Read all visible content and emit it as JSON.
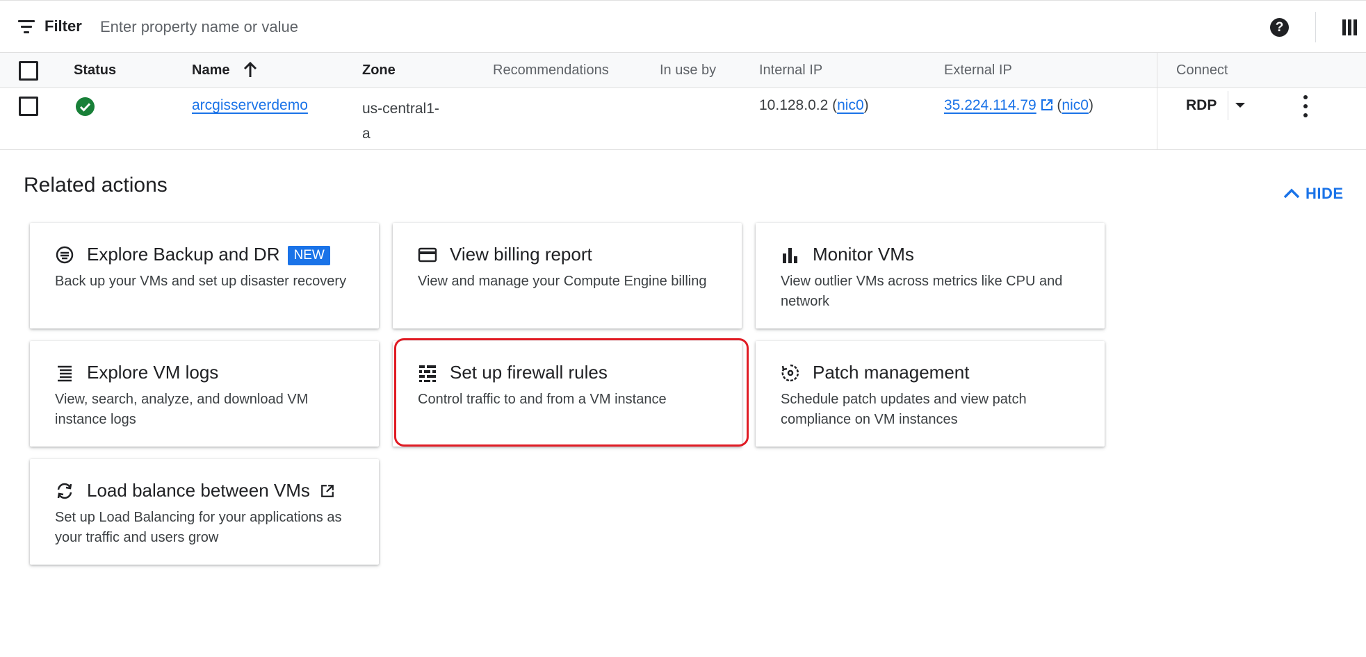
{
  "filter_bar": {
    "label": "Filter",
    "placeholder": "Enter property name or value",
    "icons": [
      "filter-icon",
      "help-icon",
      "columns-icon"
    ]
  },
  "table": {
    "headers": {
      "status": "Status",
      "name": "Name",
      "zone": "Zone",
      "recommendations": "Recommendations",
      "in_use_by": "In use by",
      "internal_ip": "Internal IP",
      "external_ip": "External IP",
      "connect": "Connect"
    },
    "sort": {
      "column": "Name",
      "direction": "ascending"
    },
    "rows": [
      {
        "status": "running",
        "name": "arcgisserverdemo",
        "zone_line1": "us-central1-",
        "zone_line2": "a",
        "recommendations": "",
        "in_use_by": "",
        "internal_ip": "10.128.0.2",
        "internal_nic": "nic0",
        "external_ip": "35.224.114.79",
        "external_nic": "nic0",
        "connect": "RDP"
      }
    ]
  },
  "related_actions": {
    "title": "Related actions",
    "hide_label": "HIDE",
    "cards": [
      {
        "title": "Explore Backup and DR",
        "badge": "NEW",
        "description": "Back up your VMs and set up disaster recovery",
        "icon": "backup-icon"
      },
      {
        "title": "View billing report",
        "description": "View and manage your Compute Engine billing",
        "icon": "credit-card-icon"
      },
      {
        "title": "Monitor VMs",
        "description": "View outlier VMs across metrics like CPU and network",
        "icon": "bar-chart-icon"
      },
      {
        "title": "Explore VM logs",
        "description": "View, search, analyze, and download VM instance logs",
        "icon": "logs-icon"
      },
      {
        "title": "Set up firewall rules",
        "description": "Control traffic to and from a VM instance",
        "icon": "firewall-icon"
      },
      {
        "title": "Patch management",
        "description": "Schedule patch updates and view patch compliance on VM instances",
        "icon": "patch-icon"
      },
      {
        "title": "Load balance between VMs",
        "description": "Set up Load Balancing for your applications as your traffic and users grow",
        "icon": "sync-icon"
      }
    ]
  },
  "colors": {
    "accent": "#1a73e8",
    "status_ok": "#188038",
    "highlight": "#e01b24"
  }
}
